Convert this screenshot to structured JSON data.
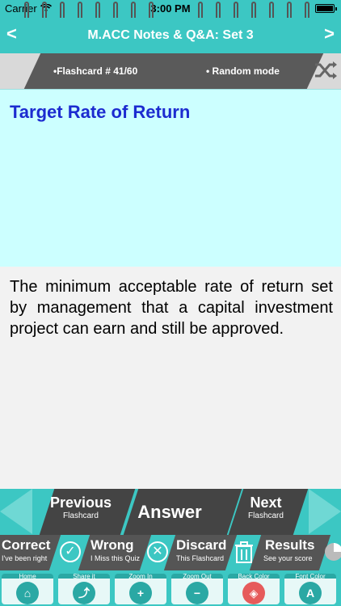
{
  "status": {
    "carrier": "Carrier",
    "time": "3:00 PM"
  },
  "nav": {
    "title": "M.ACC Notes & Q&A: Set 3",
    "back": "<",
    "forward": ">"
  },
  "info": {
    "counter": "•Flashcard #  41/60",
    "mode": "• Random mode",
    "shuffle_icon": "shuffle-icon"
  },
  "card": {
    "question": "Target Rate of Return",
    "answer": "The minimum acceptable rate of return set by management that a capital investment project can earn and still be approved."
  },
  "flash_nav": {
    "previous": "Previous",
    "previous_sub": "Flashcard",
    "answer": "Answer",
    "next": "Next",
    "next_sub": "Flashcard"
  },
  "actions": {
    "correct": "Correct",
    "correct_sub": "I've been right",
    "wrong": "Wrong",
    "wrong_sub": "I Miss this Quiz",
    "discard": "Discard",
    "discard_sub": "This Flashcard",
    "results": "Results",
    "results_sub": "See your score"
  },
  "toolbar": {
    "home": "Home",
    "share": "Share it",
    "zoom_in": "Zoom In",
    "zoom_out": "Zoom Out",
    "back_color": "Back Color",
    "font_color": "Font Color"
  },
  "colors": {
    "teal": "#3cc7c3",
    "question_bg": "#ccffff",
    "question_text": "#1c2bd0",
    "dark_panel": "#444444"
  }
}
